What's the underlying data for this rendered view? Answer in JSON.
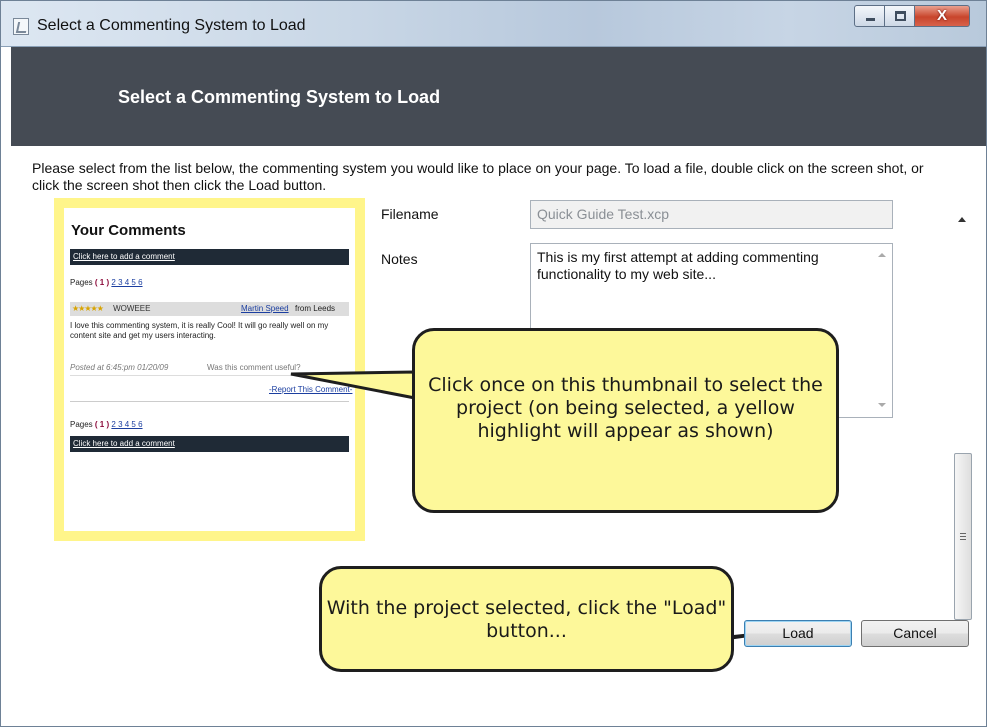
{
  "window": {
    "title": "Select a Commenting System to Load",
    "header_title": "Select a Commenting System to Load",
    "controls": {
      "minimize": "minimize",
      "maximize": "maximize",
      "close": "X"
    }
  },
  "instructions": "Please select from the list below, the commenting system you would like to place on your page. To load a file, double click on the screen shot, or click the screen shot then click the Load button.",
  "thumbnail": {
    "heading": "Your Comments",
    "add_comment_link": "Click here to add a comment",
    "pages_label": "Pages",
    "current_page": "( 1 )",
    "page_links": "2 3 4 5 6",
    "comment": {
      "stars": "★★★★★",
      "title": "WOWEEE",
      "author": "Martin Speed",
      "from": "from Leeds",
      "body": "I love this commenting system, it is really Cool! It will go really well on my content site and get my users interacting.",
      "posted": "Posted at  6:45:pm 01/20/09",
      "useful_prompt": "Was this comment useful?",
      "report_link": "-Report This Comment-"
    },
    "pages_label_bottom": "Pages",
    "current_page_bottom": "( 1 )",
    "page_links_bottom": "2 3 4 5 6",
    "add_comment_link_bottom": "Click here to add a comment",
    "highlight_color": "#fff58a"
  },
  "form": {
    "filename_label": "Filename",
    "filename_value": "Quick Guide Test.xcp",
    "notes_label": "Notes",
    "notes_value": "This is my first attempt at adding commenting functionality to my web site..."
  },
  "buttons": {
    "load": "Load",
    "cancel": "Cancel"
  },
  "callouts": {
    "thumbnail_tip": "Click once on this thumbnail to select the project (on being selected, a yellow highlight will appear as shown)",
    "load_tip": "With the project selected, click the \"Load\" button..."
  },
  "colors": {
    "header_bg": "#454b54",
    "callout_bg": "#fdf89a"
  }
}
